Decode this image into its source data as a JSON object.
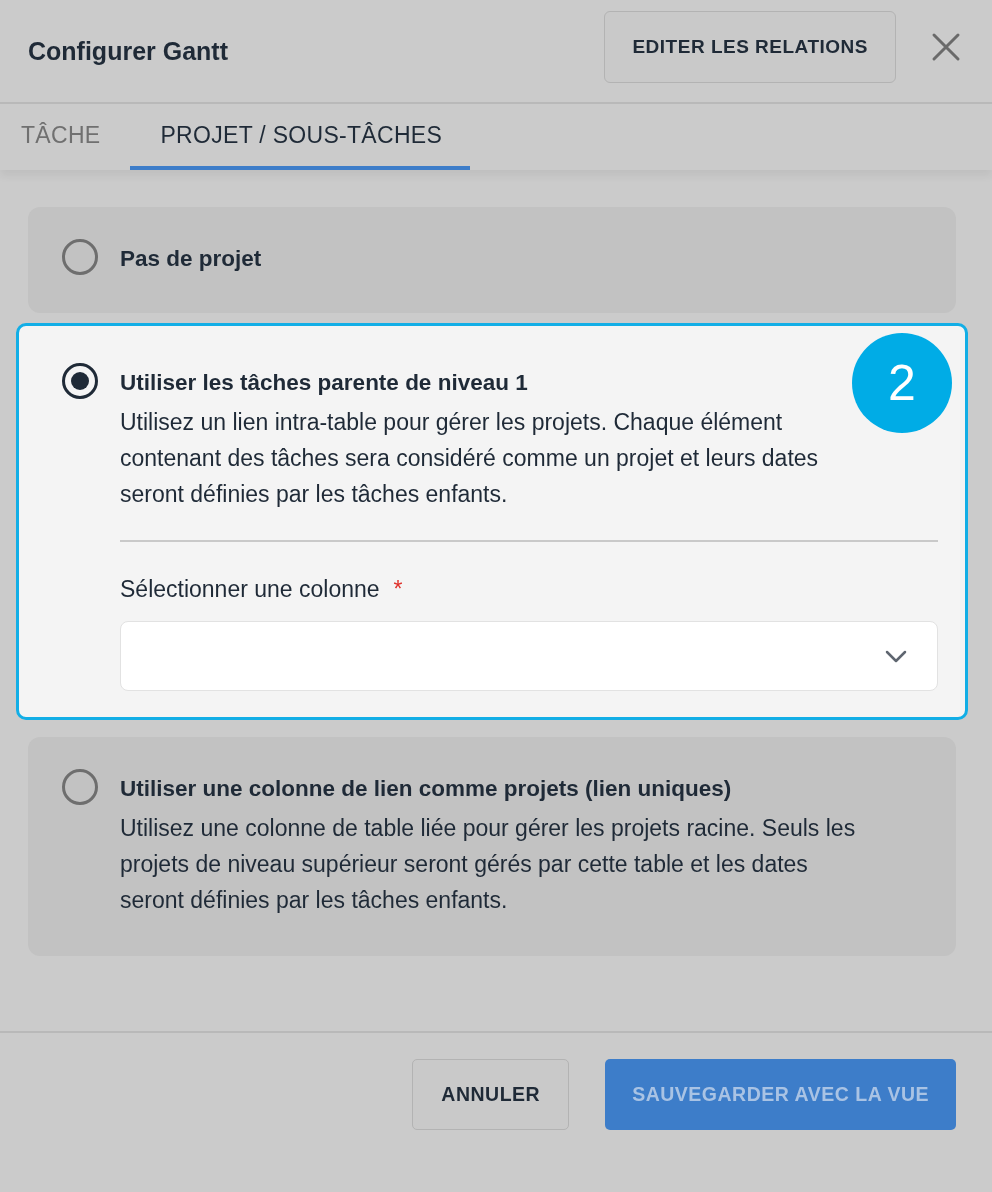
{
  "dialog": {
    "title": "Configurer Gantt",
    "header_button": "EDITER LES RELATIONS"
  },
  "tabs": [
    {
      "label": "TÂCHE",
      "selected": false
    },
    {
      "label": "PROJET / SOUS-TÂCHES",
      "selected": true
    }
  ],
  "options": [
    {
      "title": "Pas de projet",
      "selected": false
    },
    {
      "title": "Utiliser les tâches parente de niveau 1",
      "description": "Utilisez un lien intra-table pour gérer les projets. Chaque élément contenant des tâches sera considéré comme un projet et leurs dates seront définies par les tâches enfants.",
      "selected": true,
      "field": {
        "label": "Sélectionner une colonne",
        "required_mark": "*"
      },
      "badge": "2"
    },
    {
      "title": "Utiliser une colonne de lien comme projets (lien uniques)",
      "description": "Utilisez une colonne de table liée pour gérer les projets racine. Seuls les projets de niveau supérieur seront gérés par cette table et les dates seront définies par les tâches enfants.",
      "selected": false
    }
  ],
  "footer_buttons": [
    {
      "label": "ANNULER",
      "kind": "secondary"
    },
    {
      "label": "SAUVEGARDER AVEC LA VUE",
      "kind": "primary"
    }
  ]
}
